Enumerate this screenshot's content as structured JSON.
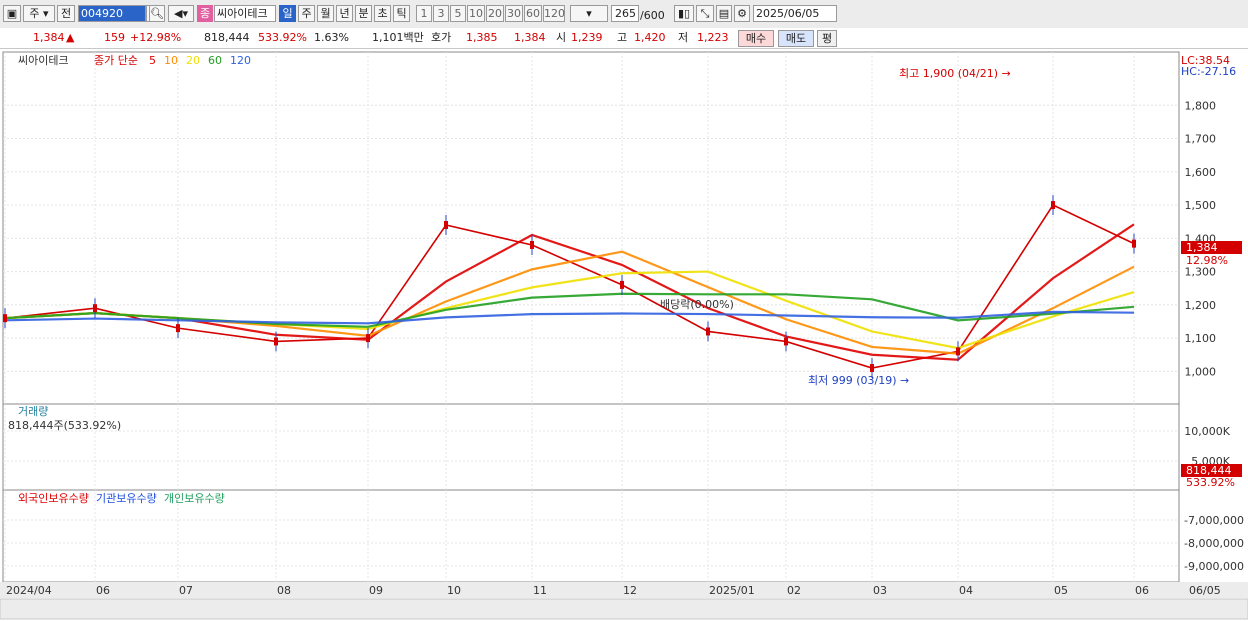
{
  "toolbar": {
    "market": "주",
    "mode": "전",
    "code": "004920",
    "stock_name": "씨아이테크",
    "tag": "종",
    "periods": [
      "일",
      "주",
      "월",
      "년",
      "분",
      "초",
      "틱"
    ],
    "active_period": "일",
    "minutes": [
      "1",
      "3",
      "5",
      "10",
      "20",
      "30",
      "60",
      "120"
    ],
    "count": "265",
    "count_max": "/600",
    "date": "2025/06/05"
  },
  "quote": {
    "price": "1,384",
    "change": "159",
    "change_pct": "+12.98%",
    "volume": "818,444",
    "vol_ratio": "533.92%",
    "turnover": "1.63%",
    "amount": "1,101백만",
    "bid_label": "호가",
    "ask": "1,385",
    "bid": "1,384",
    "open_label": "시",
    "open": "1,239",
    "high_label": "고",
    "high": "1,420",
    "low_label": "저",
    "low": "1,223",
    "buy_btn": "매수",
    "sell_btn": "매도",
    "eval_btn": "평"
  },
  "chart_data": {
    "type": "line",
    "title": "씨아이테크",
    "price_legend": {
      "label": "종가 단순",
      "periods": [
        "5",
        "10",
        "20",
        "60",
        "120"
      ],
      "colors": [
        "#e00000",
        "#ff8c00",
        "#f0e000",
        "#20a020",
        "#3060e0"
      ]
    },
    "lc": "LC:38.54",
    "hc": "HC:-27.16",
    "price_axis": {
      "ticks": [
        "1,800",
        "1,700",
        "1,600",
        "1,500",
        "1,400",
        "1,300",
        "1,200",
        "1,100",
        "1,000"
      ],
      "ylim": [
        950,
        1900
      ]
    },
    "current_price_tag": "1,384",
    "current_pct_tag": "12.98%",
    "high_annotation": "최고 1,900 (04/21)",
    "low_annotation": "최저 999 (03/19)",
    "dividend_annotation": "배당락(0.00%)",
    "x_labels": [
      "2024/04",
      "06",
      "07",
      "08",
      "09",
      "10",
      "11",
      "12",
      "2025/01",
      "02",
      "03",
      "04",
      "05",
      "06",
      "06/05"
    ],
    "close": [
      {
        "x": "2024/04",
        "y": 1160
      },
      {
        "x": "06",
        "y": 1190
      },
      {
        "x": "07",
        "y": 1130
      },
      {
        "x": "08",
        "y": 1090
      },
      {
        "x": "09",
        "y": 1100
      },
      {
        "x": "10",
        "y": 1440
      },
      {
        "x": "11",
        "y": 1380
      },
      {
        "x": "12",
        "y": 1260
      },
      {
        "x": "2025/01",
        "y": 1120
      },
      {
        "x": "02",
        "y": 1090
      },
      {
        "x": "03",
        "y": 1010
      },
      {
        "x": "04",
        "y": 1060
      },
      {
        "x": "05",
        "y": 1500
      },
      {
        "x": "06",
        "y": 1384
      }
    ],
    "volume_panel": {
      "title": "거래량",
      "value_text": "818,444주(533.92%)",
      "ticks": [
        "10,000K",
        "5,000K"
      ],
      "tag": "818,444",
      "tag_pct": "533.92%"
    },
    "holding_panel": {
      "series_names": [
        "외국인보유수량",
        "기관보유수량",
        "개인보유수량"
      ],
      "colors": [
        "#e00000",
        "#2050e0",
        "#20a060"
      ],
      "ticks": [
        "-7,000,000",
        "-8,000,000",
        "-9,000,000"
      ]
    }
  }
}
